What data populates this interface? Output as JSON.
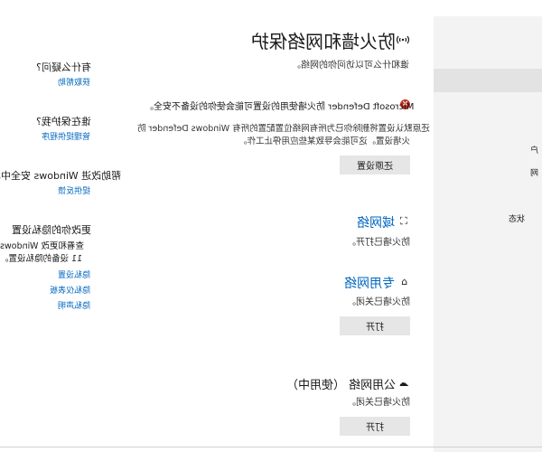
{
  "right_pane": {
    "items": [
      "户",
      "网",
      "状态"
    ]
  },
  "header": {
    "title": "防火墙和网络保护",
    "subtitle": "谁和什么可以访问你的网络。"
  },
  "warning": {
    "title": "Microsoft Defender 防火墙使用的设置可能会使你的设备不安全。",
    "body_line1": "还原默认设置将删除你已为所有网络位置配置的所有 Windows Defender 防",
    "body_line2": "火墙设置。这可能会导致某些应用停止工作。",
    "button": "还原设置"
  },
  "networks": [
    {
      "name": "域网络",
      "status": "防火墙已打开。",
      "icon": "domain-network-icon",
      "glyph": "⛶"
    },
    {
      "name": "专用网络",
      "status": "防火墙已关闭。",
      "icon": "private-network-icon",
      "glyph": "⌂",
      "button": "打开"
    },
    {
      "name": "公用网络 （使用中）",
      "status": "防火墙已关闭。",
      "icon": "public-network-icon",
      "glyph": "☁",
      "button": "打开"
    }
  ],
  "sidebar": {
    "sections": [
      {
        "heading": "有什么疑问?",
        "links": [
          "获取帮助"
        ]
      },
      {
        "heading": "谁在保护我?",
        "links": [
          "管理提供程序"
        ]
      },
      {
        "heading": "帮助改进 Windows 安全中心",
        "links": [
          "提供反馈"
        ]
      },
      {
        "heading": "更改你的隐私设置",
        "body1": "查看和更改 Windows 11 设备的隐私设置。",
        "links": [
          "隐私设置",
          "隐私仪表板",
          "隐私声明"
        ]
      }
    ]
  },
  "colors": {
    "accent": "#0067c0",
    "error": "#c42b1c",
    "button": "#e6e6e6",
    "pane": "#f3f3f3"
  }
}
